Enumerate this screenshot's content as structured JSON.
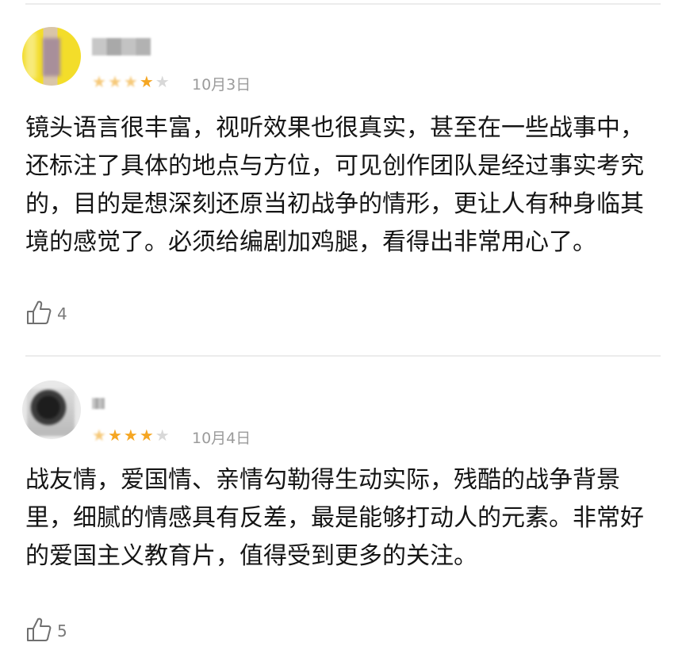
{
  "reviews": [
    {
      "date": "10月3日",
      "rating_stars": 4,
      "text": "镜头语言很丰富，视听效果也很真实，甚至在一些战事中，还标注了具体的地点与方位，可见创作团队是经过事实考究的，目的是想深刻还原当初战争的情形，更让人有种身临其境的感觉了。必须给编剧加鸡腿，看得出非常用心了。",
      "likes": "4",
      "avatar_icon": "avatar-blurred-icon",
      "like_icon": "thumbs-up-icon"
    },
    {
      "date": "10月4日",
      "rating_stars": 4,
      "text": "战友情，爱国情、亲情勾勒得生动实际，残酷的战争背景里，细腻的情感具有反差，最是能够打动人的元素。非常好的爱国主义教育片，值得受到更多的关注。",
      "likes": "5",
      "avatar_icon": "avatar-blurred-icon",
      "like_icon": "thumbs-up-icon"
    }
  ],
  "colors": {
    "star_on": "#f5a623",
    "star_off": "#d8d8d8",
    "meta_text": "#9b9b9b",
    "body_text": "#151515",
    "divider": "#ececec"
  }
}
